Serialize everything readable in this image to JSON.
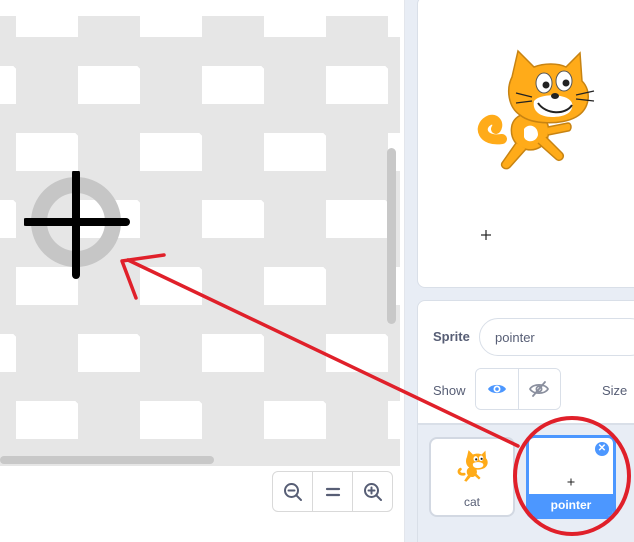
{
  "canvas": {
    "zoom_out_icon": "zoom-out-icon",
    "zoom_reset_icon": "equals-icon",
    "zoom_in_icon": "zoom-in-icon"
  },
  "sprite_info": {
    "sprite_label": "Sprite",
    "sprite_name": "pointer",
    "show_label": "Show",
    "size_label": "Size",
    "show_visible_icon": "eye-icon",
    "show_hidden_icon": "eye-slash-icon"
  },
  "sprite_list": {
    "items": [
      {
        "name": "cat",
        "selected": false
      },
      {
        "name": "pointer",
        "selected": true
      }
    ],
    "delete_icon": "close-icon"
  },
  "colors": {
    "accent": "#4c97ff",
    "annotation": "#e0202a",
    "checker": "#e6e6e6",
    "cat_orange": "#ffab19"
  }
}
